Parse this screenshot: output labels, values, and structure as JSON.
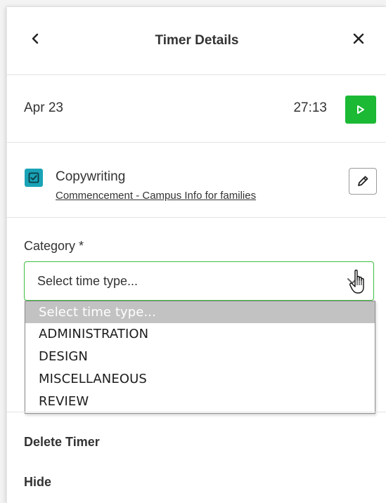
{
  "header": {
    "title": "Timer Details",
    "back_icon": "chevron-left-icon",
    "close_icon": "close-icon"
  },
  "timer": {
    "date": "Apr 23",
    "elapsed": "27:13",
    "play_icon": "play-icon",
    "play_color": "#1bb934"
  },
  "task": {
    "name": "Copywriting",
    "project": "Commencement - Campus Info for families",
    "icon": "task-checkbox-icon",
    "icon_color": "#1aa3b7",
    "edit_icon": "pencil-icon"
  },
  "category": {
    "label": "Category *",
    "selected_value": "Select time type...",
    "border_color": "#3fbf3f",
    "options": [
      "Select time type...",
      "ADMINISTRATION",
      "DESIGN",
      "MISCELLANEOUS",
      "REVIEW"
    ]
  },
  "actions": {
    "delete_label": "Delete Timer",
    "hide_label": "Hide"
  }
}
